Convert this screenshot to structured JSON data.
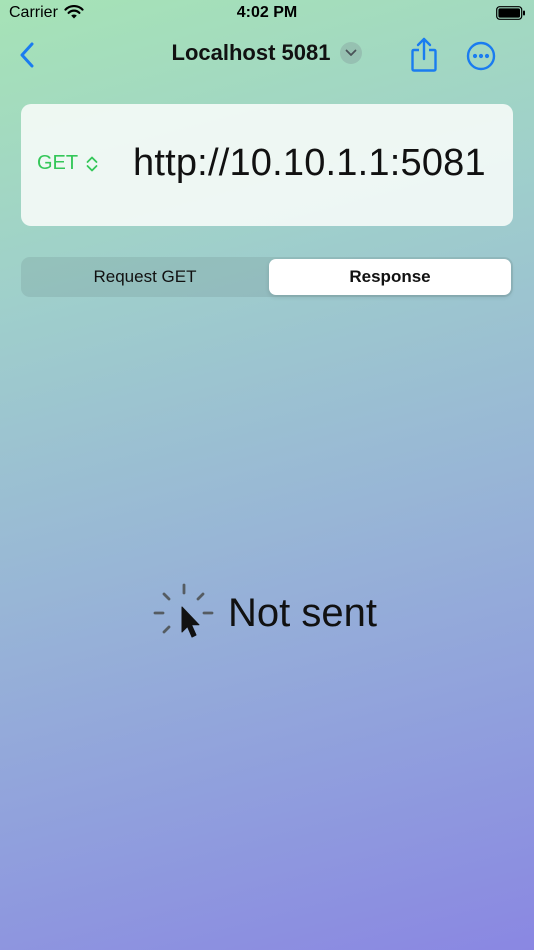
{
  "status_bar": {
    "carrier": "Carrier",
    "time": "4:02 PM"
  },
  "nav": {
    "title": "Localhost 5081",
    "back_icon": "chevron-left-icon",
    "share_icon": "share-icon",
    "more_icon": "ellipsis-circle-icon"
  },
  "request": {
    "method": "GET",
    "url": "http://10.10.1.1:5081"
  },
  "tabs": [
    {
      "label": "Request GET",
      "selected": false
    },
    {
      "label": "Response",
      "selected": true
    }
  ],
  "response": {
    "status_text": "Not sent",
    "icon": "cursor-click-icon"
  },
  "colors": {
    "accent": "#1a7cf0",
    "method": "#34c759"
  }
}
